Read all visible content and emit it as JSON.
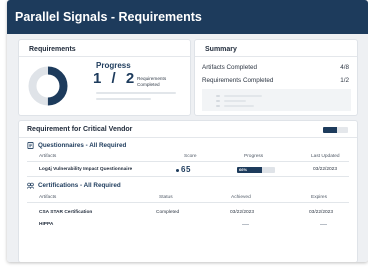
{
  "header": {
    "title": "Parallel Signals - Requirements"
  },
  "requirements_card": {
    "title": "Requirements",
    "progress_label": "Progress",
    "fraction": "1 / 2",
    "description": "Requirements Completed",
    "completed": 1,
    "total": 2
  },
  "summary_card": {
    "title": "Summary",
    "rows": [
      {
        "label": "Artifacts Completed",
        "value": "4/8"
      },
      {
        "label": "Requirements Completed",
        "value": "1/2"
      }
    ]
  },
  "vendor_card": {
    "title": "Requirement for Critical Vendor",
    "questionnaires": {
      "heading": "Questionnaires - All Required",
      "columns": {
        "artifact": "Artifacts",
        "score": "Score",
        "progress": "Progress",
        "updated": "Last Updated"
      },
      "rows": [
        {
          "artifact": "Log4j Vulnerability Impact Questionnaire",
          "score": "65",
          "progress_label": "66%",
          "progress_fraction": 0.66,
          "updated": "03/22/2023"
        }
      ]
    },
    "certifications": {
      "heading": "Certifications - All Required",
      "columns": {
        "artifact": "Artifacts",
        "status": "Status",
        "achieved": "Achieved",
        "expires": "Expires"
      },
      "rows": [
        {
          "artifact": "CSA STAR Certification",
          "status": "Completed",
          "achieved": "03/22/2023",
          "expires": "03/22/2023"
        },
        {
          "artifact": "HIPPA",
          "status": "",
          "achieved": "",
          "expires": ""
        }
      ]
    }
  },
  "colors": {
    "header": "#1d3b5c",
    "accent": "#1d3b5c",
    "track": "#dfe3e8",
    "background": "#eef0f3"
  },
  "icons": [
    "questionnaire-icon",
    "certification-icon"
  ]
}
